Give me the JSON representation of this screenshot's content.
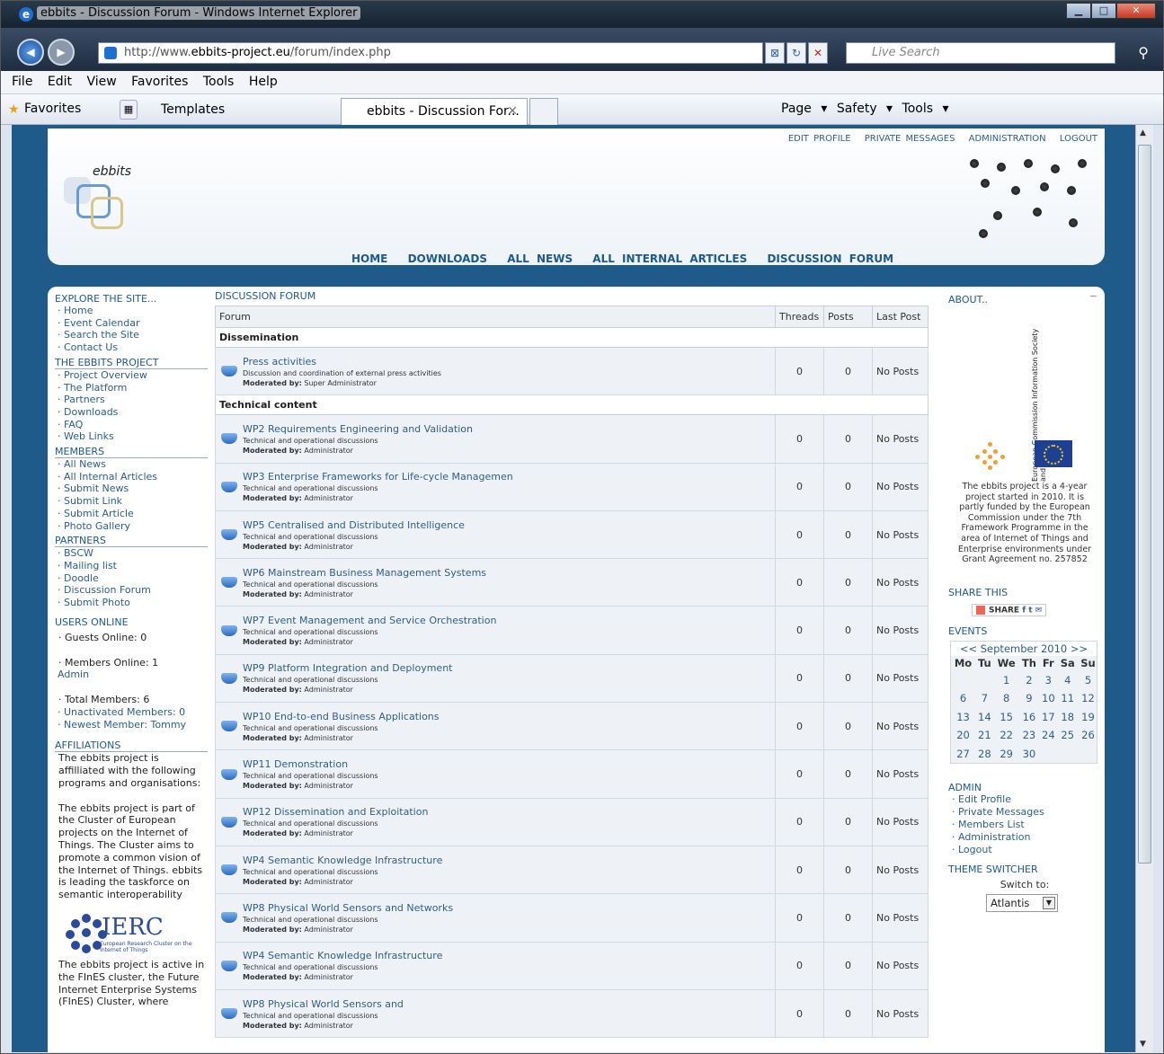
{
  "browser": {
    "title": "ebbits - Discussion Forum - Windows Internet Explorer",
    "url_prefix": "http://www.",
    "url_domain": "ebbits-project.eu",
    "url_path": "/forum/index.php",
    "search_placeholder": "Live Search",
    "menu": [
      "File",
      "Edit",
      "View",
      "Favorites",
      "Tools",
      "Help"
    ],
    "favorites_label": "Favorites",
    "templates_label": "Templates",
    "tab_title": "ebbits - Discussion For...",
    "commands": "Page ▾  Safety ▾  Tools ▾"
  },
  "site": {
    "logo_text": "ebbits",
    "top_links": [
      "EDIT PROFILE",
      "PRIVATE MESSAGES",
      "ADMINISTRATION",
      "LOGOUT"
    ],
    "main_nav": [
      "HOME",
      "DOWNLOADS",
      "ALL NEWS",
      "ALL INTERNAL ARTICLES",
      "DISCUSSION FORUM"
    ]
  },
  "left": {
    "explore_heading": "EXPLORE THE SITE...",
    "explore_items": [
      "· Home",
      "· Event Calendar",
      "· Search the Site",
      "· Contact Us"
    ],
    "project_heading": "THE EBBITS PROJECT",
    "project_items": [
      "· Project Overview",
      "· The Platform",
      "· Partners",
      "· Downloads",
      "· FAQ",
      "· Web Links"
    ],
    "members_heading": "MEMBERS",
    "members_items": [
      "· All News",
      "· All Internal Articles",
      "· Submit News",
      "· Submit Link",
      "· Submit Article",
      "· Photo Gallery"
    ],
    "partners_heading": "PARTNERS",
    "partners_items": [
      "· BSCW",
      "· Mailing list",
      "· Doodle",
      "· Discussion Forum",
      "· Submit Photo"
    ],
    "users_heading": "USERS ONLINE",
    "guests": "· Guests Online: 0",
    "members_online": "· Members Online: 1",
    "admin_user": "Admin",
    "total_members": "· Total Members: 6",
    "unactivated": "· Unactivated Members: 0",
    "newest": "· Newest Member: Tommy",
    "affiliations_heading": "AFFILIATIONS",
    "aff_text1": "The ebbits project is affilliated with the following programs and organisations:",
    "aff_text2": "The ebbits project is part of the Cluster of European projects on the Internet of Things. The Cluster aims to promote a common vision of the Internet of Things. ebbits is leading the taskforce on semantic interoperability",
    "ierc_word": "IERC",
    "ierc_sub": "European Research Cluster on the Internet of Things",
    "aff_text3": "The ebbits project is active in the FInES cluster, the Future Internet Enterprise Systems (FInES) Cluster, where"
  },
  "forum": {
    "heading": "DISCUSSION FORUM",
    "columns": [
      "Forum",
      "Threads",
      "Posts",
      "Last Post"
    ],
    "categories": [
      {
        "name": "Dissemination",
        "forums": [
          {
            "name": "Press activities",
            "desc": "Discussion and coordination of external press activities",
            "mod_label": "Moderated by:",
            "mod": "Super Administrator",
            "threads": "0",
            "posts": "0",
            "last": "No Posts"
          }
        ]
      },
      {
        "name": "Technical content",
        "forums": [
          {
            "name": "WP2 Requirements Engineering and Validation",
            "desc": "Technical and operational discussions",
            "mod_label": "Moderated by:",
            "mod": "Administrator",
            "threads": "0",
            "posts": "0",
            "last": "No Posts"
          },
          {
            "name": "WP3 Enterprise Frameworks for Life-cycle Managemen",
            "desc": "Technical and operational discussions",
            "mod_label": "Moderated by:",
            "mod": "Administrator",
            "threads": "0",
            "posts": "0",
            "last": "No Posts"
          },
          {
            "name": "WP5 Centralised and Distributed Intelligence",
            "desc": "Technical and operational discussions",
            "mod_label": "Moderated by:",
            "mod": "Administrator",
            "threads": "0",
            "posts": "0",
            "last": "No Posts"
          },
          {
            "name": "WP6 Mainstream Business Management Systems",
            "desc": "Technical and operational discussions",
            "mod_label": "Moderated by:",
            "mod": "Administrator",
            "threads": "0",
            "posts": "0",
            "last": "No Posts"
          },
          {
            "name": "WP7 Event Management and Service Orchestration",
            "desc": "Technical and operational discussions",
            "mod_label": "Moderated by:",
            "mod": "Administrator",
            "threads": "0",
            "posts": "0",
            "last": "No Posts"
          },
          {
            "name": "WP9 Platform Integration and Deployment",
            "desc": "Technical and operational discussions",
            "mod_label": "Moderated by:",
            "mod": "Administrator",
            "threads": "0",
            "posts": "0",
            "last": "No Posts"
          },
          {
            "name": "WP10 End-to-end Business Applications",
            "desc": "Technical and operational discussions",
            "mod_label": "Moderated by:",
            "mod": "Administrator",
            "threads": "0",
            "posts": "0",
            "last": "No Posts"
          },
          {
            "name": "WP11 Demonstration",
            "desc": "Technical and operational discussions",
            "mod_label": "Moderated by:",
            "mod": "Administrator",
            "threads": "0",
            "posts": "0",
            "last": "No Posts"
          },
          {
            "name": "WP12 Dissemination and Exploitation",
            "desc": "Technical and operational discussions",
            "mod_label": "Moderated by:",
            "mod": "Administrator",
            "threads": "0",
            "posts": "0",
            "last": "No Posts"
          },
          {
            "name": "WP4 Semantic Knowledge Infrastructure",
            "desc": "Technical and operational discussions",
            "mod_label": "Moderated by:",
            "mod": "Administrator",
            "threads": "0",
            "posts": "0",
            "last": "No Posts"
          },
          {
            "name": "WP8 Physical World Sensors and Networks",
            "desc": "Technical and operational discussions",
            "mod_label": "Moderated by:",
            "mod": "Administrator",
            "threads": "0",
            "posts": "0",
            "last": "No Posts"
          },
          {
            "name": "WP4 Semantic Knowledge Infrastructure",
            "desc": "Technical and operational discussions",
            "mod_label": "Moderated by:",
            "mod": "Administrator",
            "threads": "0",
            "posts": "0",
            "last": "No Posts"
          },
          {
            "name": "WP8 Physical World Sensors and",
            "desc": "Technical and operational discussions",
            "mod_label": "Moderated by:",
            "mod": "Administrator",
            "threads": "0",
            "posts": "0",
            "last": "No Posts"
          }
        ]
      }
    ]
  },
  "right": {
    "about_heading": "ABOUT..",
    "collapse": "−",
    "ec_text": "European Commission Information Society and Media",
    "about_text": "The ebbits project is a 4-year project started in 2010. It is partly funded by the European Commission under the 7th Framework Programme in the area of Internet of Things and Enterprise environments under Grant Agreement no. 257852",
    "share_heading": "SHARE THIS",
    "share_label": "SHARE",
    "events_heading": "EVENTS",
    "cal_month": "<< September 2010 >>",
    "cal_days": [
      "Mo",
      "Tu",
      "We",
      "Th",
      "Fr",
      "Sa",
      "Su"
    ],
    "cal_weeks": [
      [
        "",
        "",
        "1",
        "2",
        "3",
        "4",
        "5"
      ],
      [
        "6",
        "7",
        "8",
        "9",
        "10",
        "11",
        "12"
      ],
      [
        "13",
        "14",
        "15",
        "16",
        "17",
        "18",
        "19"
      ],
      [
        "20",
        "21",
        "22",
        "23",
        "24",
        "25",
        "26"
      ],
      [
        "27",
        "28",
        "29",
        "30",
        "",
        "",
        ""
      ]
    ],
    "admin_heading": "ADMIN",
    "admin_items": [
      "· Edit Profile",
      "· Private Messages",
      "· Members List",
      "· Administration",
      "· Logout"
    ],
    "theme_heading": "THEME SWITCHER",
    "switch_to": "Switch to:",
    "theme_value": "Atlantis"
  }
}
